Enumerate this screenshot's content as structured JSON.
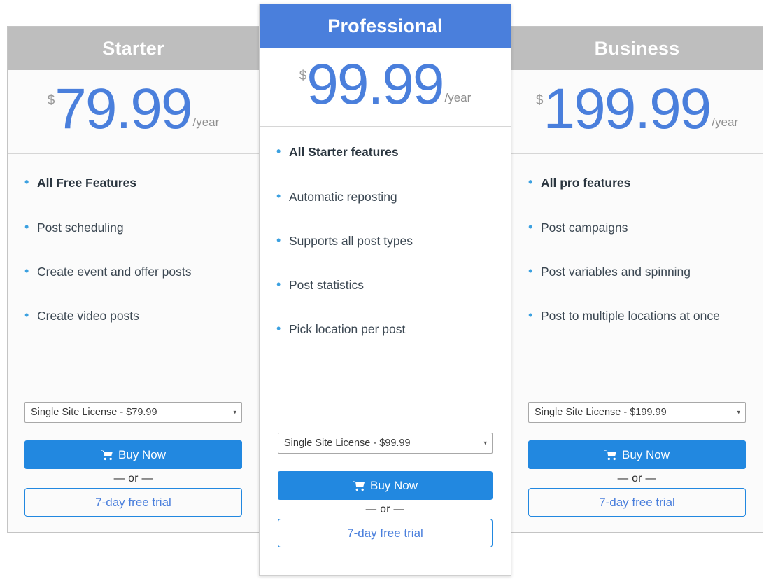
{
  "plans": [
    {
      "name": "Starter",
      "featured": false,
      "currency_symbol": "$",
      "price": "79.99",
      "period": "/year",
      "features": [
        {
          "text": "All Free Features",
          "bold": true
        },
        {
          "text": "Post scheduling",
          "bold": false
        },
        {
          "text": "Create event and offer posts",
          "bold": false
        },
        {
          "text": "Create video posts",
          "bold": false
        }
      ],
      "license_option": "Single Site License - $79.99",
      "caret": "▾",
      "buy_label": "Buy Now",
      "or_label": "— or —",
      "trial_label": "7-day free trial"
    },
    {
      "name": "Professional",
      "featured": true,
      "currency_symbol": "$",
      "price": "99.99",
      "period": "/year",
      "features": [
        {
          "text": "All Starter features",
          "bold": true
        },
        {
          "text": "Automatic reposting",
          "bold": false
        },
        {
          "text": "Supports all post types",
          "bold": false
        },
        {
          "text": "Post statistics",
          "bold": false
        },
        {
          "text": "Pick location per post",
          "bold": false
        }
      ],
      "license_option": "Single Site License - $99.99",
      "caret": "▾",
      "buy_label": "Buy Now",
      "or_label": "— or —",
      "trial_label": "7-day free trial"
    },
    {
      "name": "Business",
      "featured": false,
      "currency_symbol": "$",
      "price": "199.99",
      "period": "/year",
      "features": [
        {
          "text": "All pro features",
          "bold": true
        },
        {
          "text": "Post campaigns",
          "bold": false
        },
        {
          "text": "Post variables and spinning",
          "bold": false
        },
        {
          "text": "Post to multiple locations at once",
          "bold": false
        }
      ],
      "license_option": "Single Site License - $199.99",
      "caret": "▾",
      "buy_label": "Buy Now",
      "or_label": "— or —",
      "trial_label": "7-day free trial"
    }
  ],
  "colors": {
    "featured_header": "#4a7fdc",
    "side_header": "#bebebe",
    "price_text": "#4a7fdc",
    "buy_button": "#2288e0",
    "bullet": "#3ba0e0",
    "trial_text": "#4a7fdc"
  },
  "icons": {
    "cart": "shopping-cart-icon",
    "caret": "chevron-down-icon"
  }
}
